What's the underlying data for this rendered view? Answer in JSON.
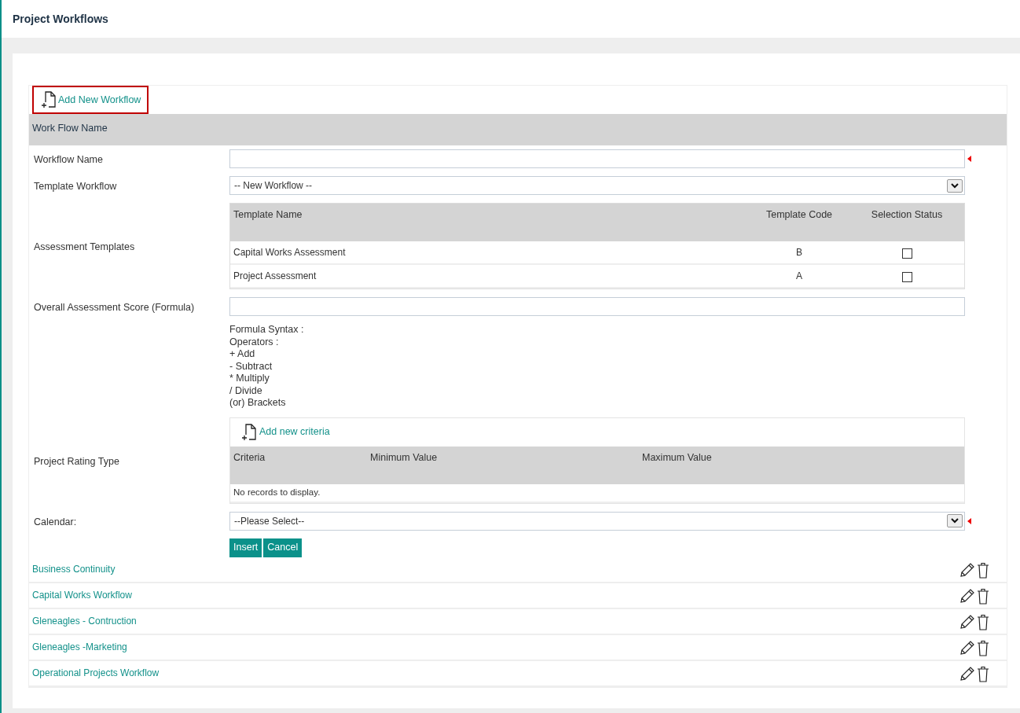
{
  "page": {
    "title": "Project Workflows"
  },
  "add_workflow": {
    "label": "Add New Workflow",
    "highlighted": true
  },
  "grid": {
    "header": "Work Flow Name"
  },
  "form": {
    "rows": [
      {
        "kind": "text",
        "label": "Workflow Name",
        "required": true
      },
      {
        "kind": "select",
        "label": "Template Workflow",
        "value": "-- New Workflow --"
      },
      {
        "kind": "templates",
        "label": "Assessment Templates",
        "columns": [
          "Template Name",
          "Template Code",
          "Selection Status"
        ],
        "rows": [
          {
            "name": "Capital Works Assessment",
            "code": "B",
            "checked": false
          },
          {
            "name": "Project Assessment",
            "code": "A",
            "checked": false
          }
        ]
      },
      {
        "kind": "formula",
        "label": "Overall Assessment Score (Formula)",
        "help": [
          "Formula Syntax :",
          "Operators :",
          "+ Add",
          "- Subtract",
          "* Multiply",
          "/ Divide",
          "(or) Brackets"
        ]
      },
      {
        "kind": "rating",
        "label": "Project Rating Type",
        "add_label": "Add new criteria",
        "columns": [
          "Criteria",
          "Minimum Value",
          "Maximum Value"
        ],
        "empty_text": "No records to display."
      },
      {
        "kind": "select",
        "label": "Calendar:",
        "value": "--Please Select--",
        "required": true
      }
    ],
    "buttons": [
      "Insert",
      "Cancel"
    ]
  },
  "workflows": [
    "Business Continuity",
    "Capital Works Workflow",
    "Gleneagles - Contruction",
    "Gleneagles -Marketing",
    "Operational Projects Workflow"
  ]
}
